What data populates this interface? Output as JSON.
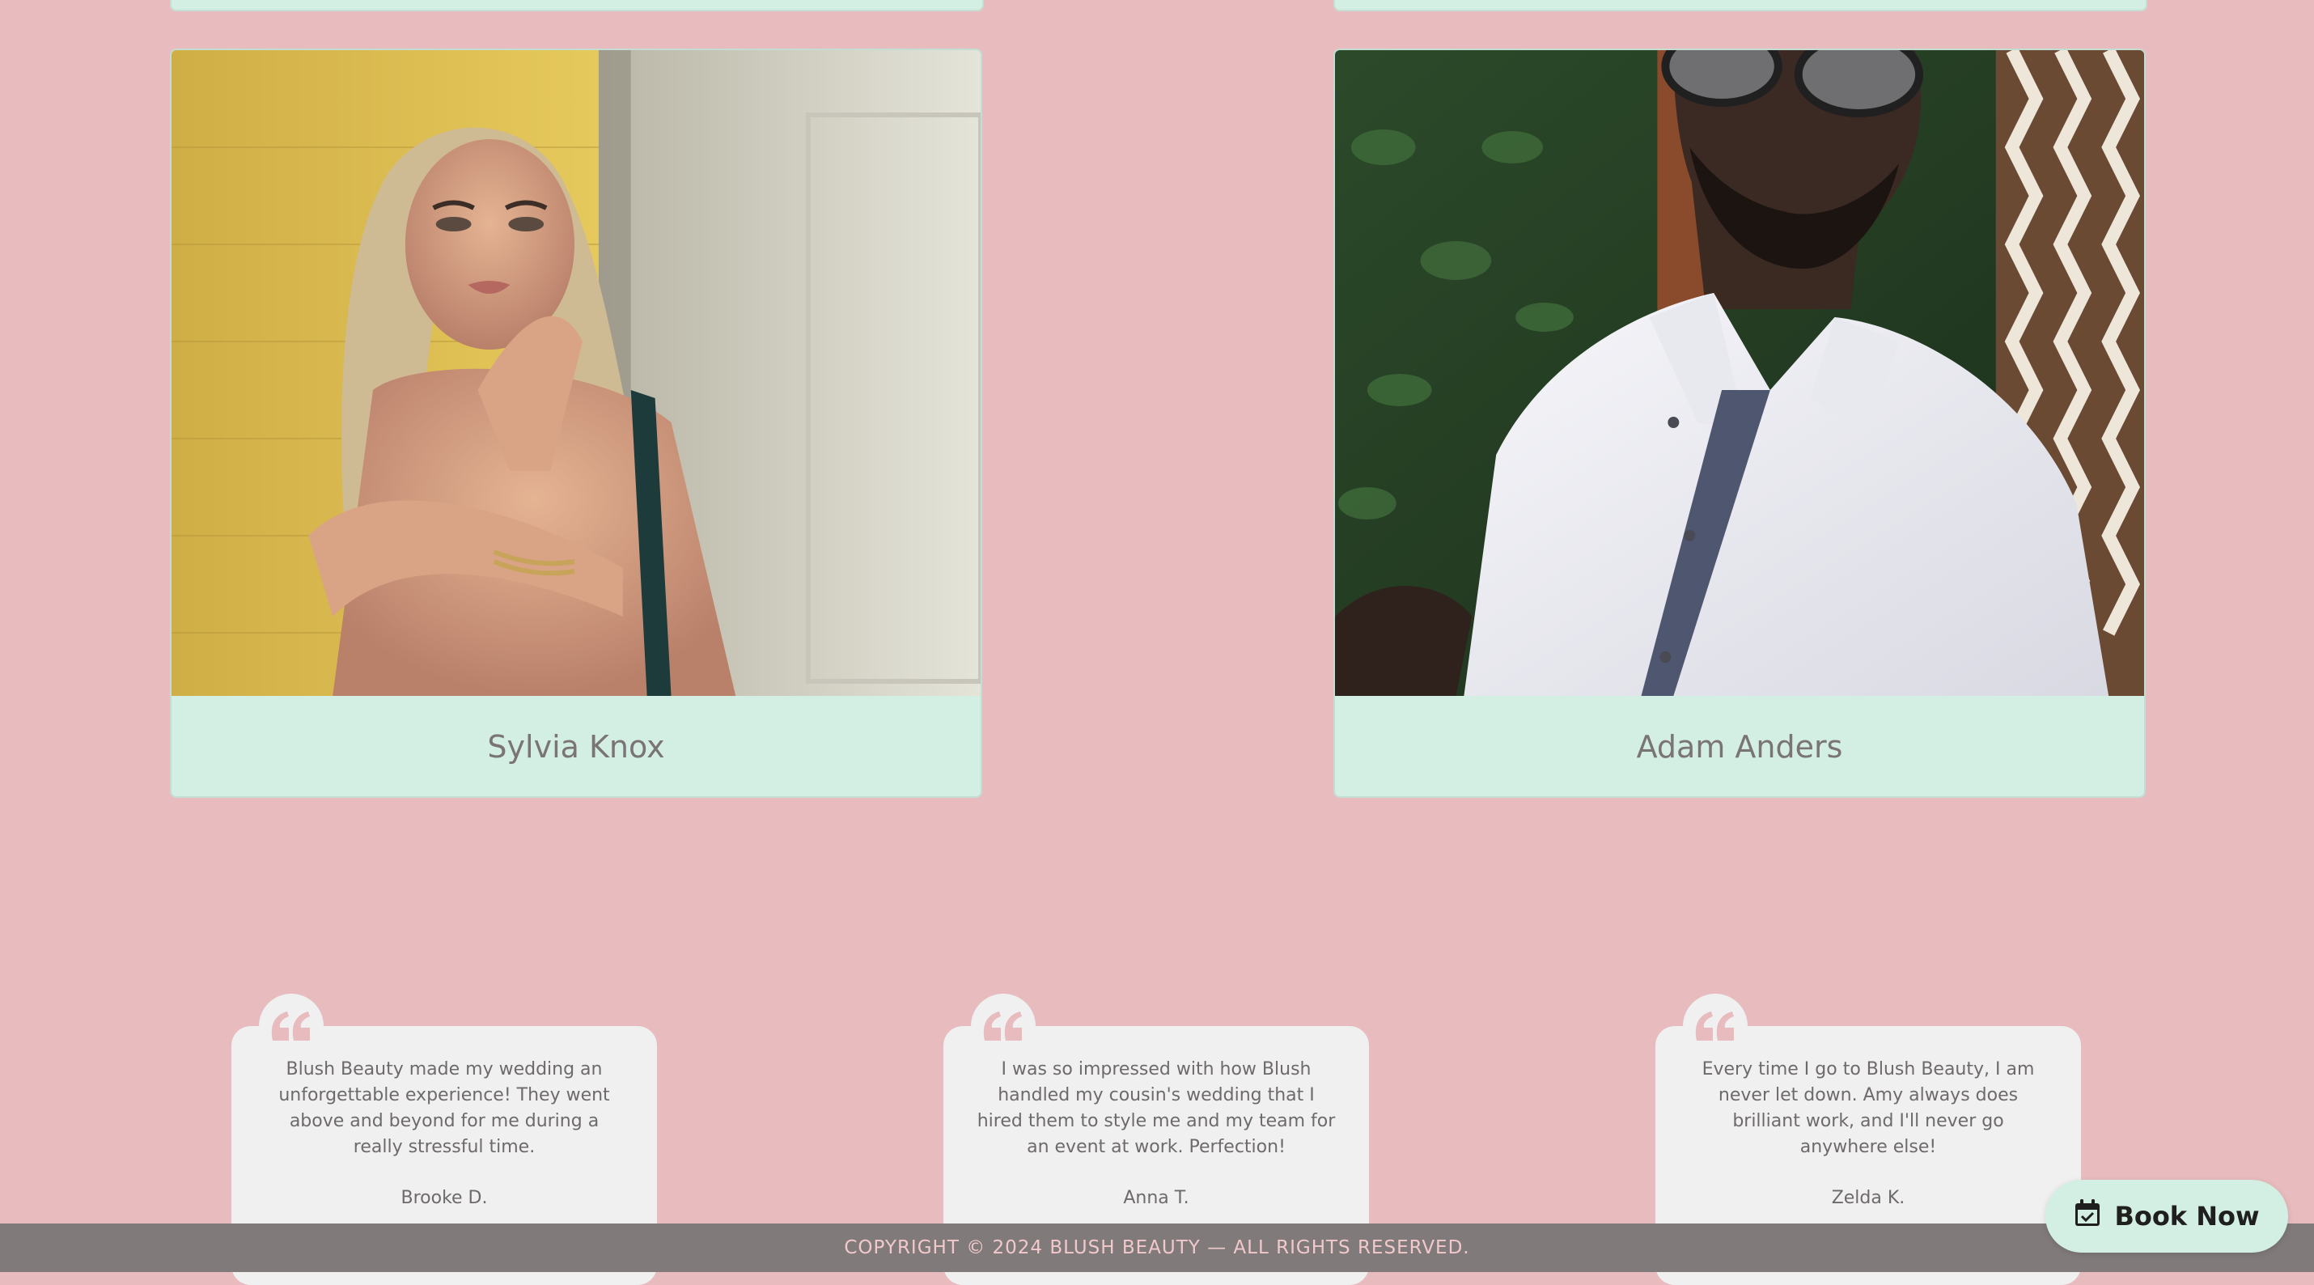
{
  "stylists": [
    {
      "name": "Sylvia Knox"
    },
    {
      "name": "Adam Anders"
    }
  ],
  "testimonials": [
    {
      "text": "Blush Beauty made my wedding an unforgettable experience! They went above and beyond for me during a really stressful time.",
      "author": "Brooke D."
    },
    {
      "text": "I was so impressed with how Blush handled my cousin's wedding that I hired them to style me and my team for an event at work. Perfection!",
      "author": "Anna T."
    },
    {
      "text": "Every time I go to Blush Beauty, I am never let down. Amy always does brilliant work, and I'll never go anywhere else!",
      "author": "Zelda K."
    }
  ],
  "footer": {
    "copyright": "COPYRIGHT © 2024 BLUSH BEAUTY — ALL RIGHTS RESERVED."
  },
  "book_now": {
    "label": "Book Now",
    "icon": "calendar-check-icon"
  },
  "colors": {
    "background": "#e8bcbe",
    "card": "#d3eee2",
    "testimonial_card": "#f0f0f0",
    "quote_mark": "#e8bcbe",
    "footer": "#807a7b",
    "footer_text": "#f2c9cb"
  }
}
